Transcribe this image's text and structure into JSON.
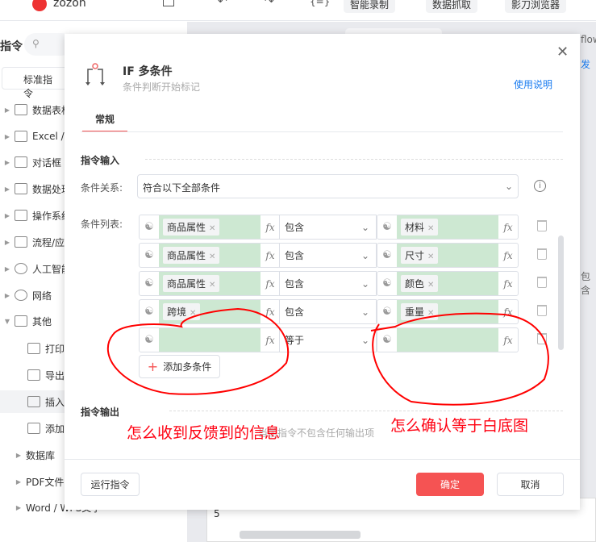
{
  "topbar": {
    "project": "zozon",
    "buttons": [
      "智能录制",
      "数据抓取",
      "影刀浏览器"
    ]
  },
  "sidebar": {
    "title": "指令",
    "tab": "标准指令",
    "items": [
      {
        "label": "数据表格",
        "icon": "table-icon"
      },
      {
        "label": "Excel /",
        "icon": "excel-icon"
      },
      {
        "label": "对话框",
        "icon": "dialog-icon"
      },
      {
        "label": "数据处理",
        "icon": "data-process-icon"
      },
      {
        "label": "操作系统",
        "icon": "os-icon"
      },
      {
        "label": "流程/应",
        "icon": "layers-icon"
      },
      {
        "label": "人工智能",
        "icon": "ai-icon"
      },
      {
        "label": "网络",
        "icon": "share-icon"
      },
      {
        "label": "其他",
        "icon": "grid-icon"
      }
    ],
    "sub_items": [
      "打印",
      "导出",
      "插入",
      "添加"
    ],
    "more_items": [
      "数据库",
      "PDF文件",
      "Word / WPS文字"
    ]
  },
  "canvas": {
    "flow_text": "flow",
    "tag": "发",
    "contains": "包含",
    "row_number": "5"
  },
  "modal": {
    "title": "IF 多条件",
    "subtitle": "条件判断开始标记",
    "help_link": "使用说明",
    "tab": "常规",
    "input_section": "指令输入",
    "relation_label": "条件关系:",
    "relation_value": "符合以下全部条件",
    "list_label": "条件列表:",
    "conditions": [
      {
        "left": "商品属性",
        "op": "包含",
        "right": "材料"
      },
      {
        "left": "商品属性",
        "op": "包含",
        "right": "尺寸"
      },
      {
        "left": "商品属性",
        "op": "包含",
        "right": "颜色"
      },
      {
        "left": "跨境",
        "op": "包含",
        "right": "重量"
      },
      {
        "left": "",
        "op": "等于",
        "right": ""
      }
    ],
    "add_condition": "添加多条件",
    "output_section": "指令输出",
    "output_empty": "当前指令不包含任何输出项",
    "run_button": "运行指令",
    "ok_button": "确定",
    "cancel_button": "取消"
  },
  "annotations": {
    "left_note": "怎么收到反馈到的信息",
    "right_note": "怎么确认等于白底图"
  },
  "colors": {
    "accent": "#f55353",
    "green": "#cde8d2",
    "link": "#1a7cf0",
    "annotation": "#ff0000"
  }
}
